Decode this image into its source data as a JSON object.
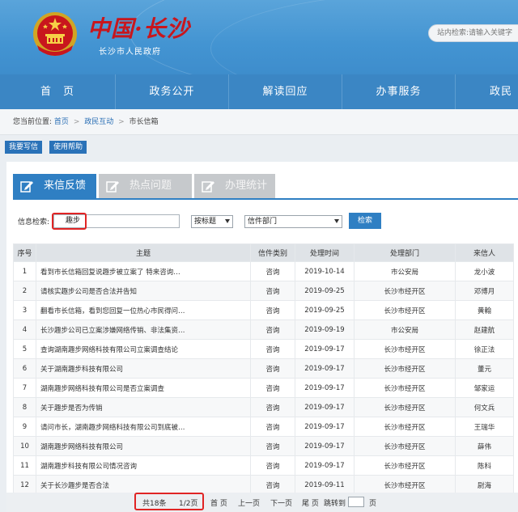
{
  "header": {
    "logo_text": "中国·长沙",
    "logo_sub": "长沙市人民政府",
    "search_placeholder": "站内检索:请输入关键字"
  },
  "nav": {
    "items": [
      "首　页",
      "政务公开",
      "解读回应",
      "办事服务",
      "政民互"
    ]
  },
  "breadcrumb": {
    "prefix": "您当前位置:",
    "items": [
      "首页",
      "政民互动",
      "市长信箱"
    ]
  },
  "actions": {
    "write_letter": "我要写信",
    "help": "使用帮助"
  },
  "tabs": [
    {
      "label": "来信反馈",
      "active": true
    },
    {
      "label": "热点问题",
      "active": false
    },
    {
      "label": "办理统计",
      "active": false
    }
  ],
  "search": {
    "label": "信息检索:",
    "keyword": "趣步",
    "field_select": "按标题",
    "dept_select": "信件部门",
    "button": "检索"
  },
  "table": {
    "headers": [
      "序号",
      "主题",
      "信件类别",
      "处理时间",
      "处理部门",
      "来信人"
    ],
    "rows": [
      [
        "1",
        "看到市长信箱回复说趣步被立案了 特来咨询…",
        "咨询",
        "2019-10-14",
        "市公安局",
        "龙小波"
      ],
      [
        "2",
        "请核实趣步公司是否合法并告知",
        "咨询",
        "2019-09-25",
        "长沙市经开区",
        "邓博月"
      ],
      [
        "3",
        "翻看市长信箱，看到您回复一位热心市民得问…",
        "咨询",
        "2019-09-25",
        "长沙市经开区",
        "黄翰"
      ],
      [
        "4",
        "长沙趣步公司已立案涉嫌网络传销、非法集资…",
        "咨询",
        "2019-09-19",
        "市公安局",
        "赵建航"
      ],
      [
        "5",
        "查询湖南趣步网络科技有限公司立案调查结论",
        "咨询",
        "2019-09-17",
        "长沙市经开区",
        "徐正法"
      ],
      [
        "6",
        "关于湖南趣步科技有限公司",
        "咨询",
        "2019-09-17",
        "长沙市经开区",
        "董元"
      ],
      [
        "7",
        "湖南趣步网络科技有限公司是否立案调查",
        "咨询",
        "2019-09-17",
        "长沙市经开区",
        "邹家运"
      ],
      [
        "8",
        "关于趣步是否为传销",
        "咨询",
        "2019-09-17",
        "长沙市经开区",
        "何文兵"
      ],
      [
        "9",
        "请问市长，湖南趣步网络科技有限公司到底被…",
        "咨询",
        "2019-09-17",
        "长沙市经开区",
        "王瑞华"
      ],
      [
        "10",
        "湖南趣步网络科技有限公司",
        "咨询",
        "2019-09-17",
        "长沙市经开区",
        "薛伟"
      ],
      [
        "11",
        "湖南趣步科技有限公司情况咨询",
        "咨询",
        "2019-09-17",
        "长沙市经开区",
        "陈科"
      ],
      [
        "12",
        "关于长沙趣步是否合法",
        "咨询",
        "2019-09-11",
        "长沙市经开区",
        "尉海"
      ]
    ]
  },
  "pager": {
    "total": "共18条",
    "page": "1/2页",
    "first": "首 页",
    "prev": "上一页",
    "next": "下一页",
    "last": "尾 页",
    "goto": "跳转到",
    "suffix": "页"
  },
  "colors": {
    "header_blue": "#4394d2",
    "nav_blue": "#3b86c4",
    "accent_red": "#e02424",
    "tab_blue": "#2f7fc3"
  }
}
